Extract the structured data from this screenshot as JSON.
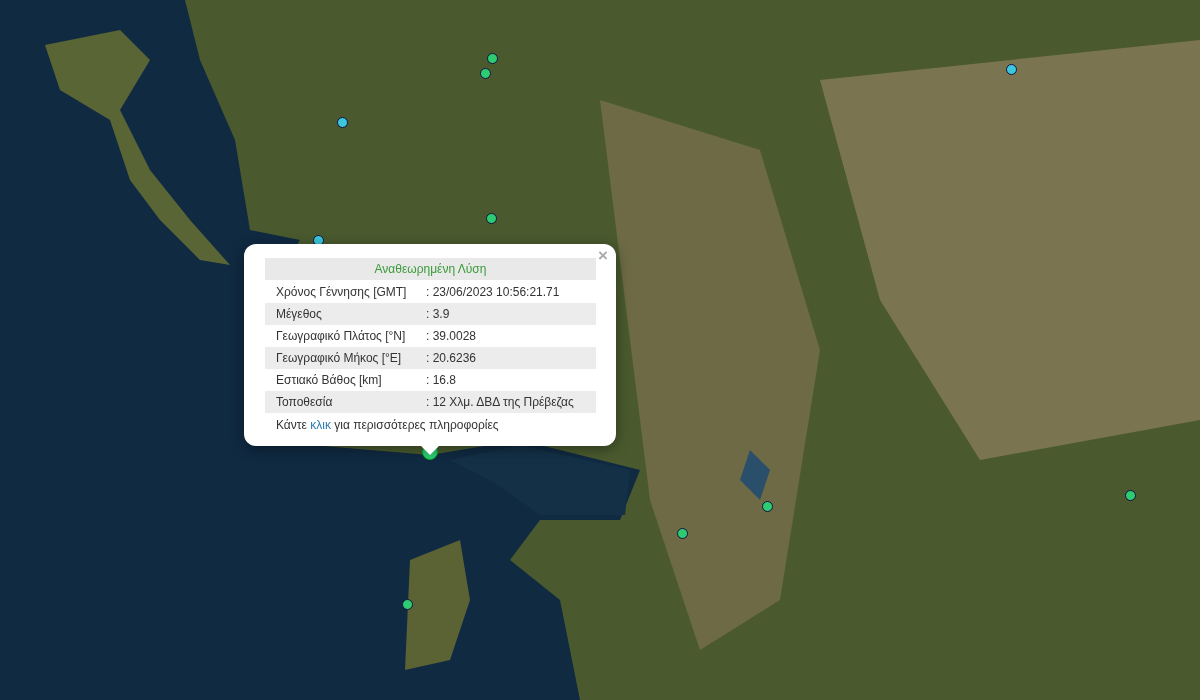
{
  "markers": [
    {
      "color": "#2ecc71",
      "selected": false
    },
    {
      "color": "#2ecc71",
      "selected": false
    },
    {
      "color": "#3cc8dc",
      "selected": false
    },
    {
      "color": "#3cc8dc",
      "selected": false
    },
    {
      "color": "#2ecc71",
      "selected": false
    },
    {
      "color": "#3cc8dc",
      "selected": false
    },
    {
      "color": "#2ecc71",
      "selected": true
    },
    {
      "color": "#2ecc71",
      "selected": false
    },
    {
      "color": "#2ecc71",
      "selected": false
    },
    {
      "color": "#2ecc71",
      "selected": false
    },
    {
      "color": "#2ecc71",
      "selected": false
    }
  ],
  "popup": {
    "close": "×",
    "title": "Αναθεωρημένη Λύση",
    "rows": [
      {
        "label": "Χρόνος Γέννησης [GMT]",
        "value": ": 23/06/2023 10:56:21.71"
      },
      {
        "label": "Μέγεθος",
        "value": ": 3.9"
      },
      {
        "label": "Γεωγραφικό Πλάτος [°N]",
        "value": ": 39.0028"
      },
      {
        "label": "Γεωγραφικό Μήκος [°E]",
        "value": ": 20.6236"
      },
      {
        "label": "Εστιακό Βάθος [km]",
        "value": ": 16.8"
      },
      {
        "label": "Τοποθεσία",
        "value": ": 12 Χλμ. ΔΒΔ της Πρέβεζας"
      }
    ],
    "footer": {
      "before": "Κάντε ",
      "link": "κλικ",
      "after": " για περισσότερες πληροφορίες"
    }
  }
}
